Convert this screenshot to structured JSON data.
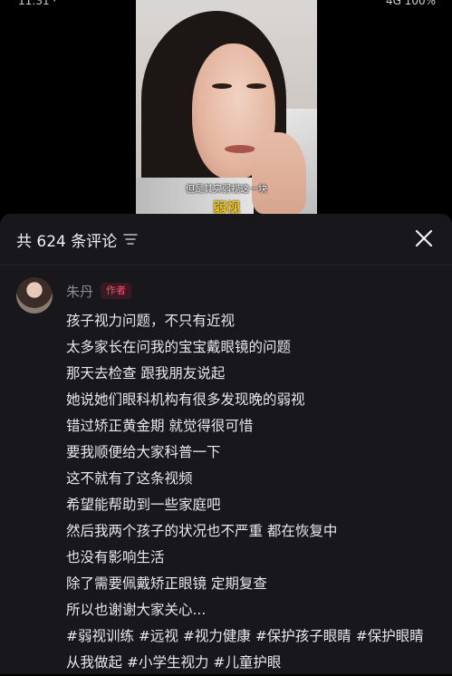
{
  "video": {
    "subtitle": "但是其实弱视这一块",
    "big_subtitle": "弱视"
  },
  "status_bar": {
    "left_text": "11:31 ·",
    "right_text": "4G 100%"
  },
  "comments_sheet": {
    "count_label": "共 624 条评论",
    "close_icon": "close-icon",
    "filter_icon": "filter-icon"
  },
  "comment": {
    "author": "朱丹",
    "badge": "作者",
    "lines": [
      "孩子视力问题，不只有近视",
      "太多家长在问我的宝宝戴眼镜的问题",
      "那天去检查 跟我朋友说起",
      "她说她们眼科机构有很多发现晚的弱视",
      "错过矫正黄金期 就觉得很可惜",
      "要我顺便给大家科普一下",
      "这不就有了这条视频",
      "希望能帮助到一些家庭吧",
      "然后我两个孩子的状况也不严重 都在恢复中",
      "也没有影响生活",
      "除了需要佩戴矫正眼镜 定期复查",
      "所以也谢谢大家关心..."
    ],
    "hashtags": [
      "#弱视训练",
      "#远视",
      "#视力健康",
      "#保护孩子眼睛",
      "#保护眼睛从我做起",
      "#小学生视力",
      "#儿童护眼"
    ]
  }
}
